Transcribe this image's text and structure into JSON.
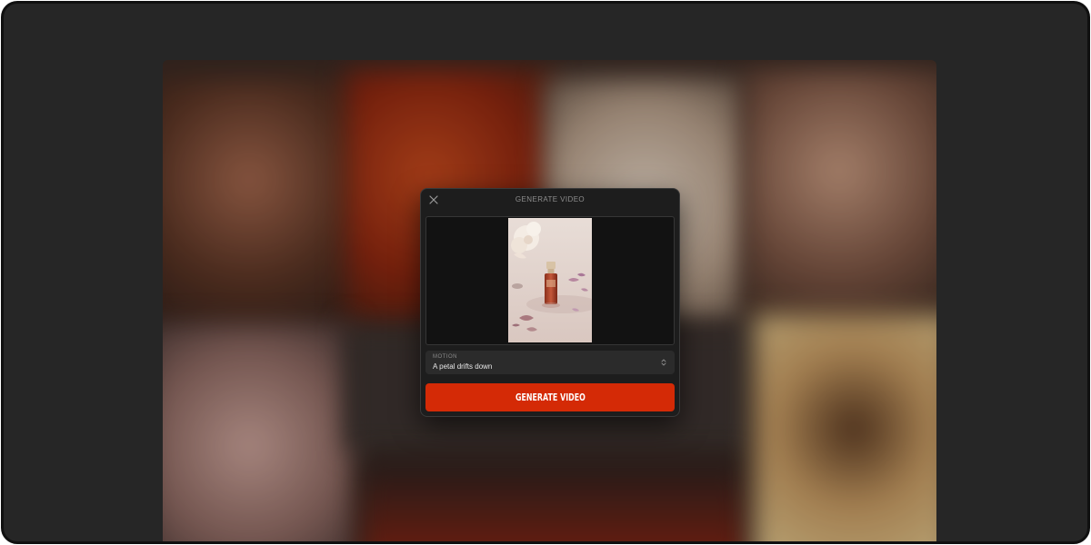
{
  "modal": {
    "title": "GENERATE VIDEO",
    "close_icon": "close-icon",
    "preview_image": "perfume-bottle-with-flower-and-petals",
    "motion": {
      "label": "MOTION",
      "value": "A petal drifts down",
      "icon": "chevron-up-down-icon"
    },
    "generate_button_label": "GENERATE VIDEO"
  },
  "colors": {
    "accent": "#d42a06",
    "modal_bg": "#1d1d1d",
    "device_bg": "#262626"
  }
}
